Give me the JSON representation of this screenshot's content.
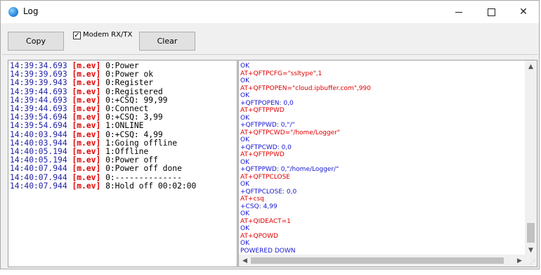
{
  "window": {
    "title": "Log",
    "icon": "globe-app-icon",
    "controls": {
      "minimize": "—",
      "maximize": "□",
      "close": "✕"
    }
  },
  "toolbar": {
    "copy_label": "Copy",
    "modem_checkbox_label": "Modem RX/TX",
    "modem_checked": true,
    "checkmark": "✓",
    "clear_label": "Clear"
  },
  "log": [
    {
      "time": "14:39:34.693",
      "tag": "[m.ev]",
      "msg": "0:Power"
    },
    {
      "time": "14:39:39.693",
      "tag": "[m.ev]",
      "msg": "0:Power ok"
    },
    {
      "time": "14:39:39.943",
      "tag": "[m.ev]",
      "msg": "0:Register"
    },
    {
      "time": "14:39:44.693",
      "tag": "[m.ev]",
      "msg": "0:Registered"
    },
    {
      "time": "14:39:44.693",
      "tag": "[m.ev]",
      "msg": "0:+CSQ: 99,99"
    },
    {
      "time": "14:39:44.693",
      "tag": "[m.ev]",
      "msg": "0:Connect"
    },
    {
      "time": "14:39:54.694",
      "tag": "[m.ev]",
      "msg": "0:+CSQ: 3,99"
    },
    {
      "time": "14:39:54.694",
      "tag": "[m.ev]",
      "msg": "1:ONLINE"
    },
    {
      "time": "14:40:03.944",
      "tag": "[m.ev]",
      "msg": "0:+CSQ: 4,99"
    },
    {
      "time": "14:40:03.944",
      "tag": "[m.ev]",
      "msg": "1:Going offline"
    },
    {
      "time": "14:40:05.194",
      "tag": "[m.ev]",
      "msg": "1:Offline"
    },
    {
      "time": "14:40:05.194",
      "tag": "[m.ev]",
      "msg": "0:Power off"
    },
    {
      "time": "14:40:07.944",
      "tag": "[m.ev]",
      "msg": "0:Power off done"
    },
    {
      "time": "14:40:07.944",
      "tag": "[m.ev]",
      "msg": "0:--------------"
    },
    {
      "time": "14:40:07.944",
      "tag": "[m.ev]",
      "msg": "8:Hold off 00:02:00"
    }
  ],
  "modem": [
    {
      "text": "OK",
      "kind": "rx"
    },
    {
      "text": "AT+QFTPCFG=\"ssltype\",1",
      "kind": "tx"
    },
    {
      "text": "OK",
      "kind": "rx"
    },
    {
      "text": "AT+QFTPOPEN=\"cloud.ipbuffer.com\",990",
      "kind": "tx"
    },
    {
      "text": "OK",
      "kind": "rx"
    },
    {
      "text": "+QFTPOPEN: 0,0",
      "kind": "rx"
    },
    {
      "text": "AT+QFTPPWD",
      "kind": "tx"
    },
    {
      "text": "OK",
      "kind": "rx"
    },
    {
      "text": "+QFTPPWD: 0,\"/\"",
      "kind": "rx"
    },
    {
      "text": "AT+QFTPCWD=\"/home/Logger\"",
      "kind": "tx"
    },
    {
      "text": "OK",
      "kind": "rx"
    },
    {
      "text": "+QFTPCWD: 0,0",
      "kind": "rx"
    },
    {
      "text": "AT+QFTPPWD",
      "kind": "tx"
    },
    {
      "text": "OK",
      "kind": "rx"
    },
    {
      "text": "+QFTPPWD: 0,\"/home/Logger/\"",
      "kind": "rx"
    },
    {
      "text": "AT+QFTPCLOSE",
      "kind": "tx"
    },
    {
      "text": "OK",
      "kind": "rx"
    },
    {
      "text": "+QFTPCLOSE: 0,0",
      "kind": "rx"
    },
    {
      "text": "AT+csq",
      "kind": "tx"
    },
    {
      "text": "+CSQ: 4,99",
      "kind": "rx"
    },
    {
      "text": "OK",
      "kind": "rx"
    },
    {
      "text": "AT+QIDEACT=1",
      "kind": "tx"
    },
    {
      "text": "OK",
      "kind": "rx"
    },
    {
      "text": "AT+QPOWD",
      "kind": "tx"
    },
    {
      "text": "OK",
      "kind": "rx"
    },
    {
      "text": "POWERED DOWN",
      "kind": "rx"
    }
  ],
  "scroll": {
    "up_arrow": "▲",
    "down_arrow": "▼",
    "left_arrow": "◀",
    "right_arrow": "▶",
    "grip": "⋰"
  },
  "colors": {
    "timestamp": "#2020a8",
    "tag": "#e00000",
    "rx": "#1616d0",
    "tx": "#e00000"
  }
}
